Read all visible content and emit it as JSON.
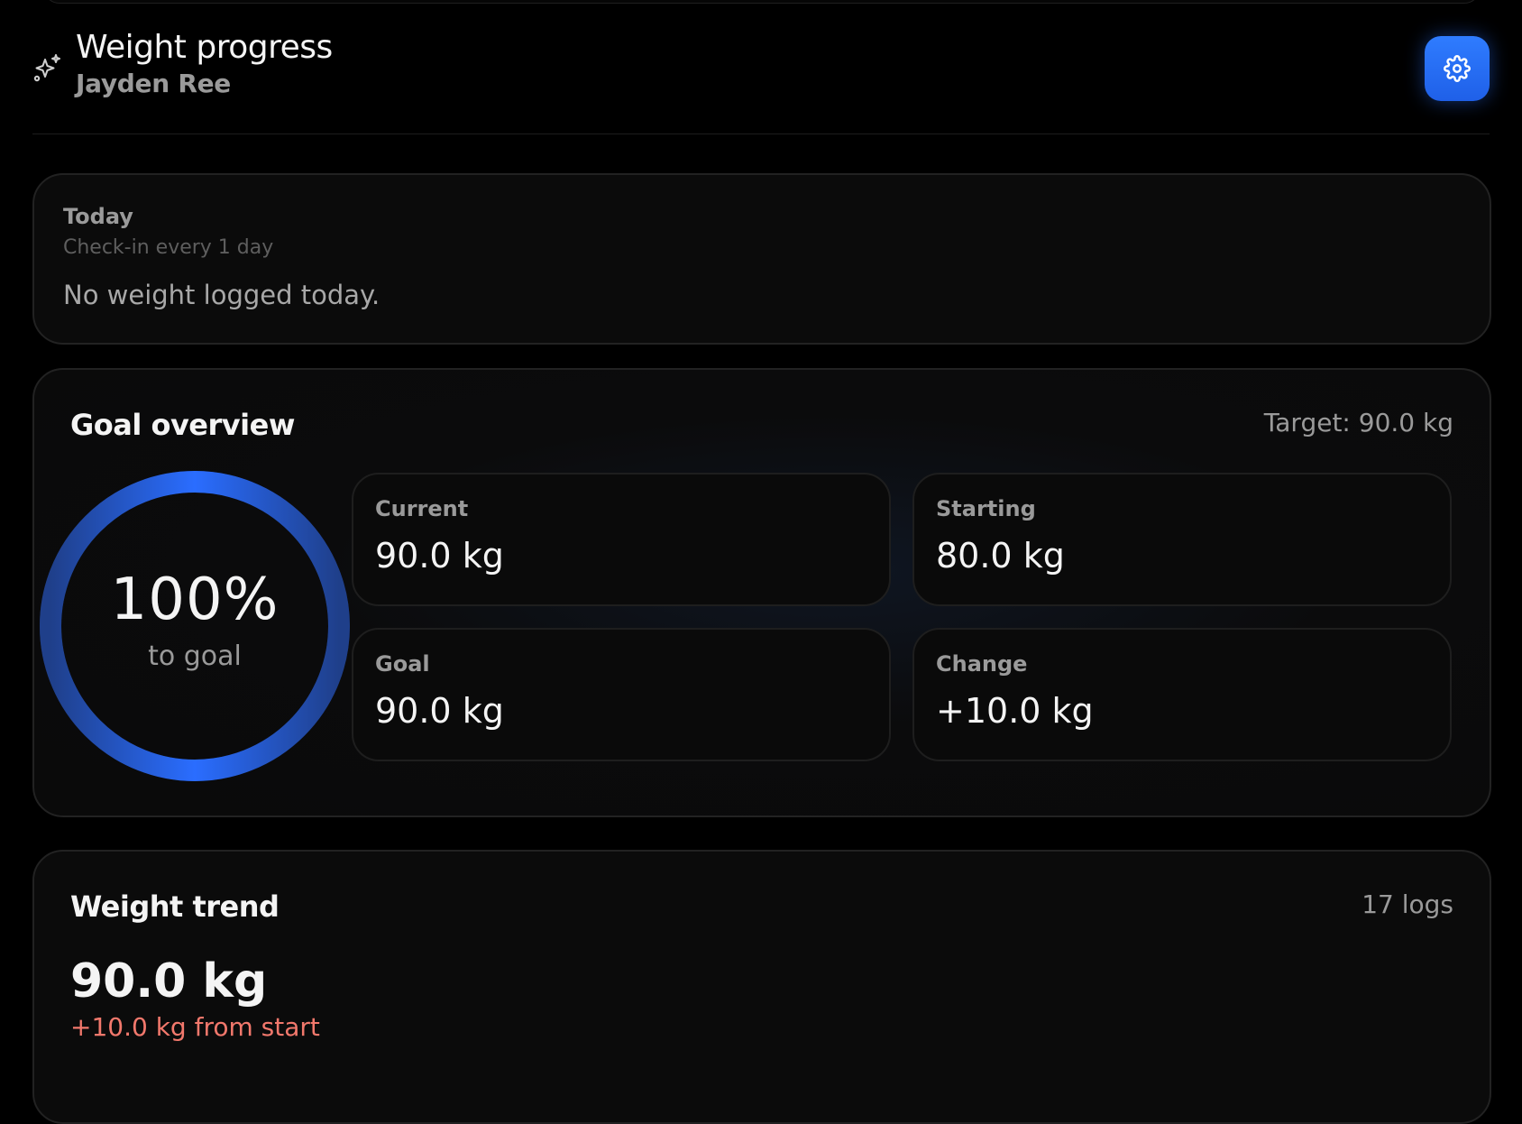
{
  "header": {
    "title": "Weight progress",
    "subtitle": "Jayden Ree",
    "settings_icon": "gear-icon",
    "leading_icon": "sparkle-icon",
    "accent_color": "#2f7cff"
  },
  "today": {
    "label": "Today",
    "frequency": "Check-in every 1 day",
    "message": "No weight logged today."
  },
  "goal_overview": {
    "title": "Goal overview",
    "target": "Target: 90.0 kg",
    "progress_percent": "100%",
    "progress_fraction": 1.0,
    "progress_sub": "to goal",
    "stats": [
      {
        "label": "Current",
        "value": "90.0 kg"
      },
      {
        "label": "Starting",
        "value": "80.0 kg"
      },
      {
        "label": "Goal",
        "value": "90.0 kg"
      },
      {
        "label": "Change",
        "value": "+10.0 kg"
      }
    ]
  },
  "weight_trend": {
    "title": "Weight trend",
    "logs": "17 logs",
    "latest": "90.0 kg",
    "delta": "+10.0 kg from start",
    "delta_color": "#f2786c"
  }
}
